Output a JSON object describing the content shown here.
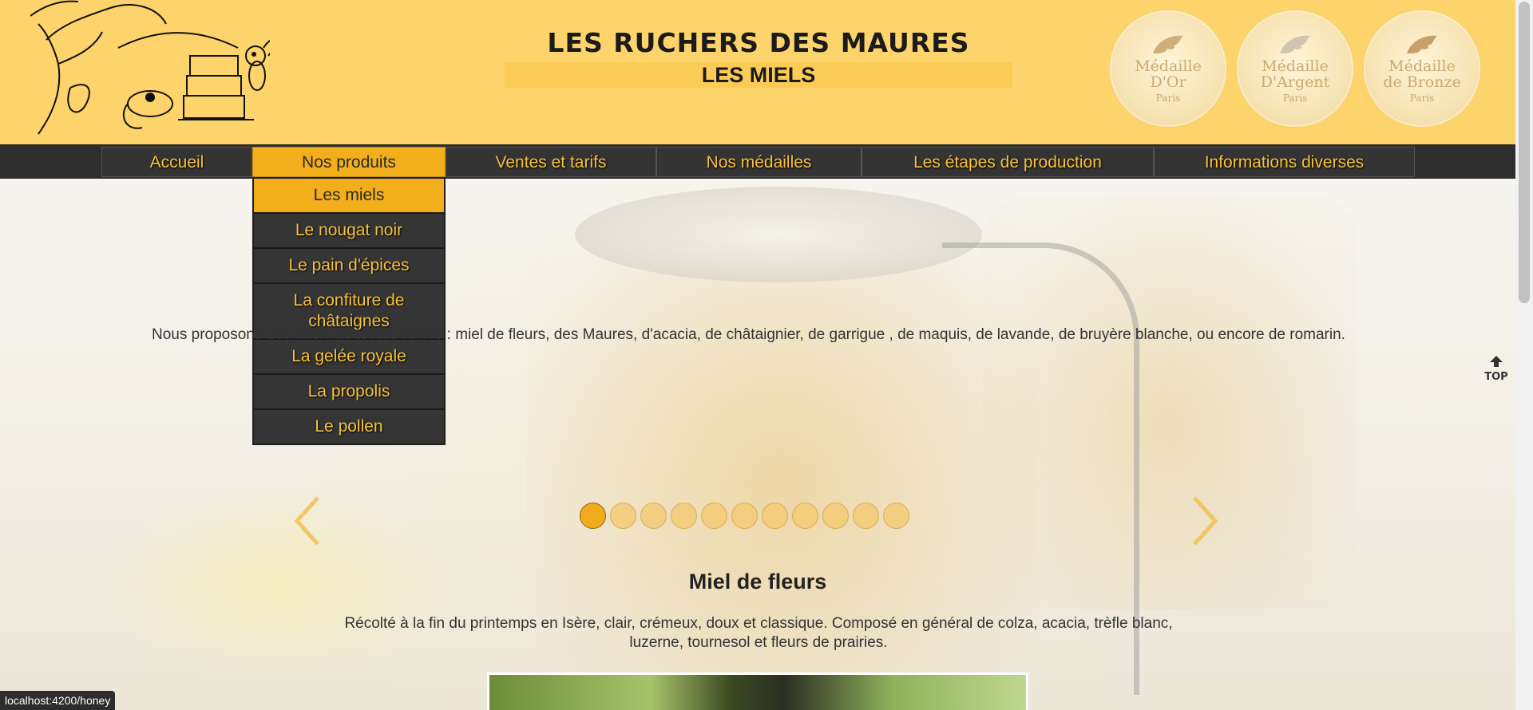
{
  "header": {
    "site_title": "LES RUCHERS DES MAURES",
    "page_subtitle": "LES MIELS",
    "medals": [
      {
        "line1": "Médaille",
        "line2": "D'Or",
        "line3": "Paris"
      },
      {
        "line1": "Médaille",
        "line2": "D'Argent",
        "line3": "Paris"
      },
      {
        "line1": "Médaille",
        "line2": "de Bronze",
        "line3": "Paris"
      }
    ]
  },
  "nav": {
    "items": [
      {
        "label": "Accueil"
      },
      {
        "label": "Nos produits"
      },
      {
        "label": "Ventes et tarifs"
      },
      {
        "label": "Nos médailles"
      },
      {
        "label": "Les étapes de production"
      },
      {
        "label": "Informations diverses"
      }
    ],
    "active_index": 1
  },
  "dropdown": {
    "items": [
      {
        "label": "Les miels"
      },
      {
        "label": "Le nougat noir"
      },
      {
        "label": "Le pain d'épices"
      },
      {
        "label": "La confiture de châtaignes"
      },
      {
        "label": "La gelée royale"
      },
      {
        "label": "La propolis"
      },
      {
        "label": "Le pollen"
      }
    ],
    "active_index": 0
  },
  "content": {
    "intro": "Nous proposons des miels de toutes sortes : miel de fleurs, des Maures, d'acacia, de châtaignier, de garrigue , de maquis, de lavande, de bruyère blanche, ou encore de romarin.",
    "carousel": {
      "slide_count": 11,
      "active_index": 0,
      "slide_title": "Miel de fleurs",
      "slide_description": "Récolté à la fin du printemps en Isère, clair, crémeux, doux et classique. Composé en général de colza, acacia, trèfle blanc, luzerne, tournesol et fleurs de prairies."
    }
  },
  "top_button": {
    "label": "TOP"
  },
  "status_bar": {
    "url": "localhost:4200/honey"
  },
  "colors": {
    "header_bg": "#fdd46b",
    "nav_bg": "#2e2e2e",
    "accent": "#f2ae1b",
    "nav_text": "#f7c03a"
  }
}
